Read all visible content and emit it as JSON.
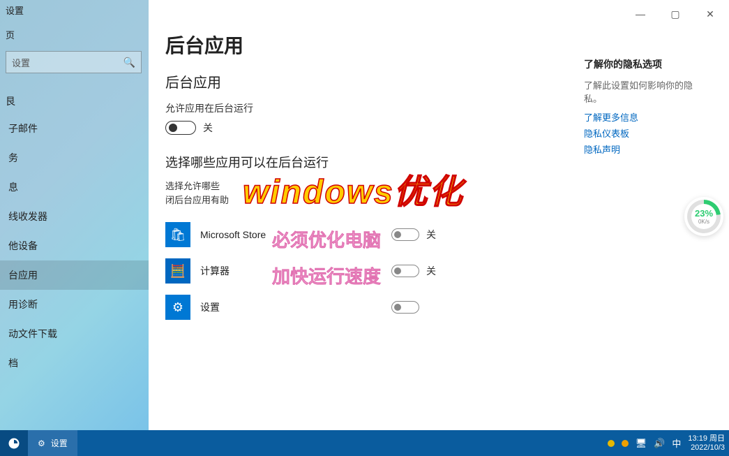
{
  "window_title": "设置",
  "sidebar": {
    "home": "页",
    "search_placeholder": "设置",
    "section": "艮",
    "items": [
      {
        "label": "子邮件"
      },
      {
        "label": "务"
      },
      {
        "label": "息"
      },
      {
        "label": "线收发器"
      },
      {
        "label": "他设备"
      },
      {
        "label": "台应用"
      },
      {
        "label": "用诊断"
      },
      {
        "label": "动文件下载"
      },
      {
        "label": "档"
      }
    ],
    "active_index": 5
  },
  "main": {
    "title": "后台应用",
    "section_heading": "后台应用",
    "allow_label": "允许应用在后台运行",
    "toggle_state": "关",
    "choose_heading": "选择哪些应用可以在后台运行",
    "choose_desc_1": "选择允许哪些",
    "choose_desc_2": "闭后台应用有助",
    "apps": [
      {
        "name": "Microsoft Store",
        "state": "关",
        "icon": "store"
      },
      {
        "name": "计算器",
        "state": "关",
        "icon": "calc"
      },
      {
        "name": "设置",
        "state": "",
        "icon": "settings"
      }
    ]
  },
  "right": {
    "heading": "了解你的隐私选项",
    "desc": "了解此设置如何影响你的隐私。",
    "links": [
      "了解更多信息",
      "隐私仪表板",
      "隐私声明"
    ]
  },
  "perf": {
    "pct": "23%",
    "sub": "0K/s"
  },
  "overlay": {
    "title": "windows优化",
    "sub1": "必须优化电脑",
    "sub2": "加快运行速度"
  },
  "taskbar": {
    "active_label": "设置",
    "ime": "中",
    "time": "13:19",
    "day": "周日",
    "date": "2022/10/3"
  }
}
